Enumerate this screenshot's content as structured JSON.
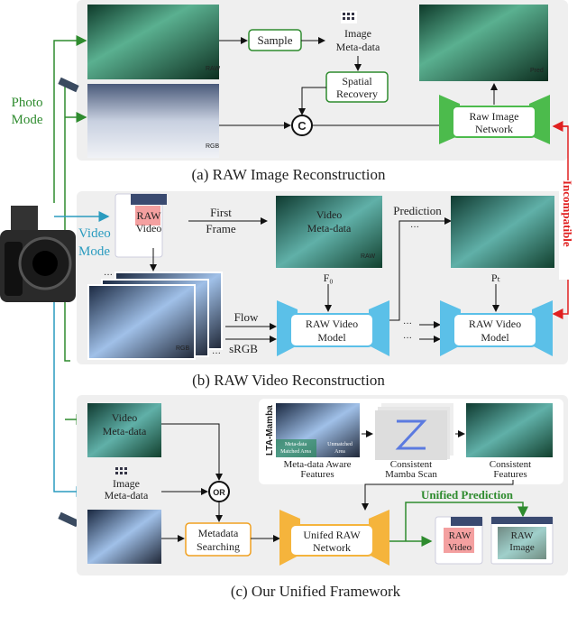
{
  "colors": {
    "photo": "#2e8b2e",
    "video": "#2a9bbf",
    "incompatible": "#e02020",
    "unified": "#f0a020",
    "panel": "#efefef"
  },
  "modes": {
    "photo": [
      "Photo",
      "Mode"
    ],
    "video": [
      "Video",
      "Mode"
    ]
  },
  "panel_a": {
    "caption": "(a) RAW Image Reconstruction",
    "sample": "Sample",
    "meta": [
      "Image",
      "Meta-data"
    ],
    "spatial": [
      "Spatial",
      "Recovery"
    ],
    "concat": "C",
    "network": [
      "Raw Image",
      "Network"
    ],
    "tags": {
      "raw": "RAW",
      "rgb": "RGB",
      "pred": "Pred"
    }
  },
  "panel_b": {
    "caption": "(b) RAW Video Reconstruction",
    "raw_video": [
      "RAW",
      "Video"
    ],
    "first_frame": [
      "First",
      "Frame"
    ],
    "video_meta": [
      "Video",
      "Meta-data"
    ],
    "f0": "F₀",
    "pt": "Pₜ",
    "prediction": "Prediction",
    "flow": "Flow",
    "srgb": "sRGB",
    "model": [
      "RAW Video",
      "Model"
    ],
    "ellipsis": "···",
    "tags": {
      "raw": "RAW",
      "rgb": "RGB"
    }
  },
  "incompatible": "Incompatible",
  "panel_c": {
    "caption": "(c) Our Unified Framework",
    "video_meta": [
      "Video",
      "Meta-data"
    ],
    "image_meta": [
      "Image",
      "Meta-data"
    ],
    "or": "OR",
    "search": [
      "Metadata",
      "Searching"
    ],
    "network": [
      "Unifed RAW",
      "Network"
    ],
    "unified_prediction": "Unified Prediction",
    "raw_video": [
      "RAW",
      "Video"
    ],
    "raw_image": [
      "RAW",
      "Image"
    ],
    "lta": {
      "title": "LTA-Mamba",
      "matched": [
        "Meta-data",
        "Matched Area"
      ],
      "unmatched": [
        "Unmatched",
        "Area"
      ],
      "f1": [
        "Meta-data Aware",
        "Features"
      ],
      "f2": [
        "Consistent",
        "Mamba Scan"
      ],
      "f3": [
        "Consistent",
        "Features"
      ]
    }
  }
}
